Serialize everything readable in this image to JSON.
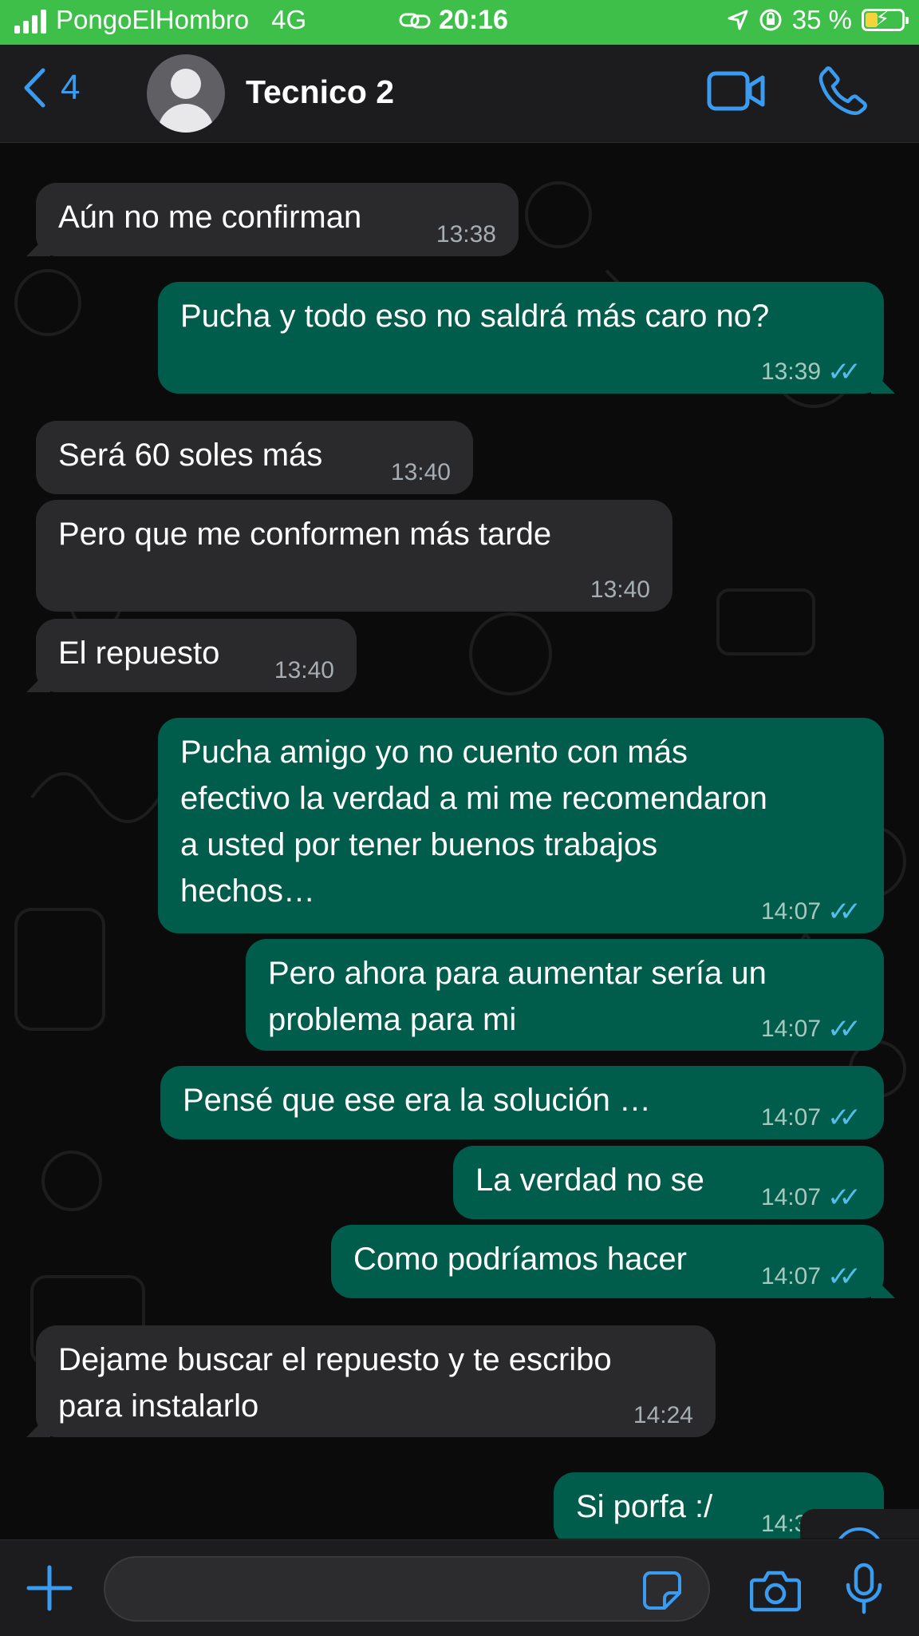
{
  "status_bar": {
    "carrier": "PongoElHombro",
    "network": "4G",
    "time": "20:16",
    "battery": "35 %",
    "battery_level": 0.35,
    "battery_color": "#f6d33a",
    "bar_color": "#3dbf4a"
  },
  "header": {
    "back_count": "4",
    "contact_name": "Tecnico 2",
    "icons": [
      "chevron-left-icon",
      "avatar",
      "video-camera-icon",
      "phone-icon"
    ],
    "accent": "#3a9cf0"
  },
  "messages": [
    {
      "direction": "incoming",
      "lines": [
        "Aún no me confirman"
      ],
      "time": "13:38"
    },
    {
      "direction": "outgoing",
      "lines": [
        "Pucha y todo eso no saldrá más caro no?"
      ],
      "time": "13:39",
      "read": true
    },
    {
      "direction": "incoming",
      "lines": [
        "Será 60 soles más"
      ],
      "time": "13:40"
    },
    {
      "direction": "incoming",
      "lines": [
        "Pero que me conformen más tarde"
      ],
      "time": "13:40"
    },
    {
      "direction": "incoming",
      "lines": [
        "El repuesto"
      ],
      "time": "13:40"
    },
    {
      "direction": "outgoing",
      "lines": [
        "Pucha amigo yo no cuento con más",
        "efectivo la verdad a mi me recomendaron",
        "a usted por tener buenos trabajos",
        "hechos…"
      ],
      "time": "14:07",
      "read": true
    },
    {
      "direction": "outgoing",
      "lines": [
        "Pero ahora para aumentar sería un",
        "problema para mi"
      ],
      "time": "14:07",
      "read": true
    },
    {
      "direction": "outgoing",
      "lines": [
        "Pensé que ese era la solución …"
      ],
      "time": "14:07",
      "read": true
    },
    {
      "direction": "outgoing",
      "lines": [
        "La verdad no se"
      ],
      "time": "14:07",
      "read": true
    },
    {
      "direction": "outgoing",
      "lines": [
        "Como podríamos hacer"
      ],
      "time": "14:07",
      "read": true
    },
    {
      "direction": "incoming",
      "lines": [
        "Dejame buscar el repuesto y te escribo",
        "para instalarlo"
      ],
      "time": "14:24"
    },
    {
      "direction": "outgoing",
      "lines": [
        "Si porfa :/"
      ],
      "time": "14:31",
      "read": true
    }
  ],
  "read_ticks": "✓✓",
  "colors": {
    "incoming_bubble": "#2a2a2c",
    "outgoing_bubble": "#005c4b",
    "read_receipt": "#53bdeb"
  },
  "input_bar": {
    "icons": [
      "plus-icon",
      "sticker-icon",
      "camera-icon",
      "microphone-icon"
    ]
  },
  "scroll_button_icon": "chevron-down-circle-icon"
}
